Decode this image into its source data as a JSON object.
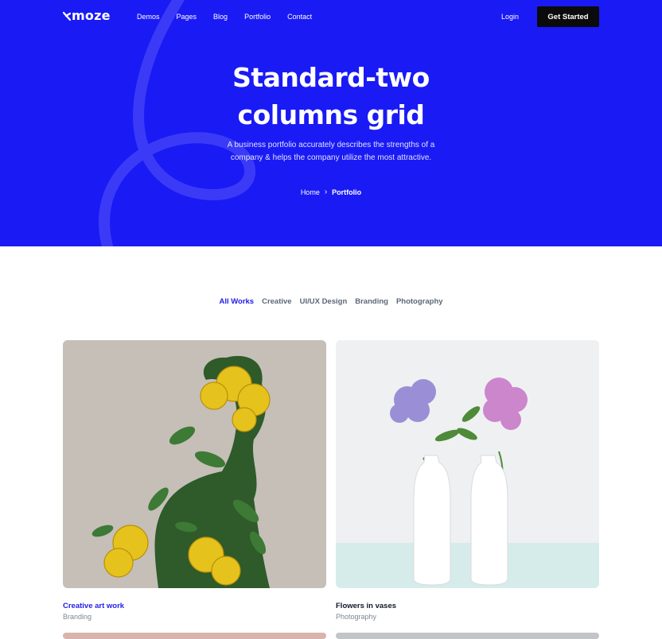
{
  "brand": {
    "name": "moze",
    "accent": "#1a1af5"
  },
  "nav": {
    "items": [
      {
        "label": "Demos"
      },
      {
        "label": "Pages"
      },
      {
        "label": "Blog"
      },
      {
        "label": "Portfolio"
      },
      {
        "label": "Contact"
      }
    ],
    "login": "Login",
    "cta": "Get Started"
  },
  "hero": {
    "title_line1": "Standard-two",
    "title_line2": "columns grid",
    "subtitle": "A business portfolio accurately describes the strengths of a company & helps the company utilize the most attractive.",
    "breadcrumb": {
      "home": "Home",
      "current": "Portfolio",
      "separator_icon": "chevron-right-icon"
    }
  },
  "filters": [
    {
      "label": "All Works",
      "active": true
    },
    {
      "label": "Creative",
      "active": false
    },
    {
      "label": "UI/UX Design",
      "active": false
    },
    {
      "label": "Branding",
      "active": false
    },
    {
      "label": "Photography",
      "active": false
    }
  ],
  "portfolio": [
    {
      "title": "Creative art work",
      "category": "Branding",
      "title_color": "#2121e6"
    },
    {
      "title": "Flowers in vases",
      "category": "Photography",
      "title_color": "#111827"
    }
  ]
}
